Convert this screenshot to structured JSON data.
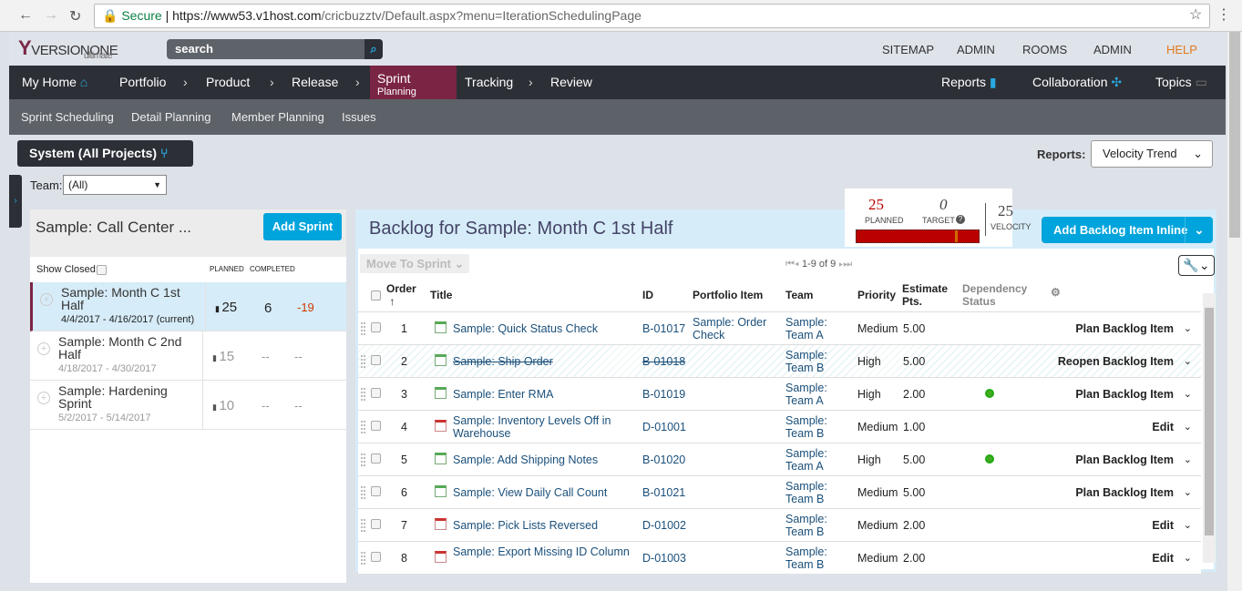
{
  "browser": {
    "secure": "Secure",
    "url_host": "https://www53.v1host.com",
    "url_path": "/cricbuzztv/Default.aspx?menu=IterationSchedulingPage"
  },
  "header": {
    "logo": "VERSIONONE",
    "logo_sub": "ultimate",
    "search_placeholder": "search",
    "links": [
      "SITEMAP",
      "ADMIN",
      "ROOMS",
      "ADMIN",
      "HELP"
    ]
  },
  "nav": {
    "items": [
      "My Home",
      "Portfolio",
      "Product",
      "Release",
      "Sprint",
      "Planning",
      "Tracking",
      "Review"
    ],
    "right": [
      "Reports",
      "Collaboration",
      "Topics"
    ]
  },
  "subnav": [
    "Sprint Scheduling",
    "Detail Planning",
    "Member Planning",
    "Issues"
  ],
  "scope": "System (All Projects)",
  "reports": {
    "label": "Reports:",
    "value": "Velocity Trend"
  },
  "team": {
    "label": "Team:",
    "value": "(All)"
  },
  "left": {
    "title": "Sample: Call Center ...",
    "add_sprint": "Add Sprint",
    "show_closed": "Show Closed:",
    "planned": "PLANNED",
    "completed": "COMPLETED",
    "sprints": [
      {
        "name": "Sample: Month C 1st Half",
        "dates": "4/4/2017 - 4/16/2017 (current)",
        "planned": "25",
        "completed": "6",
        "diff": "-19"
      },
      {
        "name": "Sample: Month C 2nd Half",
        "dates": "4/18/2017 - 4/30/2017",
        "planned": "15",
        "completed": "--",
        "diff": "--"
      },
      {
        "name": "Sample: Hardening Sprint",
        "dates": "5/2/2017 - 5/14/2017",
        "planned": "10",
        "completed": "--",
        "diff": "--"
      }
    ]
  },
  "backlog": {
    "title": "Backlog for Sample: Month C 1st Half",
    "add_inline": "Add Backlog Item Inline",
    "move_to_sprint": "Move To Sprint",
    "pager": "1-9 of 9",
    "velocity": {
      "planned": "25",
      "planned_label": "PLANNED",
      "target": "0",
      "target_label": "TARGET",
      "velocity": "25",
      "velocity_label": "VELOCITY"
    },
    "columns": [
      "Order",
      "Title",
      "ID",
      "Portfolio Item",
      "Team",
      "Priority",
      "Estimate Pts.",
      "Dependency Status"
    ],
    "rows": [
      {
        "order": "1",
        "title": "Sample: Quick Status Check",
        "id": "B-01017",
        "portfolio": "Sample: Order Check",
        "team": "Sample: Team A",
        "priority": "Medium",
        "est": "5.00",
        "action": "Plan Backlog Item",
        "type": "story",
        "dep": false,
        "closed": false
      },
      {
        "order": "2",
        "title": "Sample: Ship Order",
        "id": "B-01018",
        "portfolio": "",
        "team": "Sample: Team B",
        "priority": "High",
        "est": "5.00",
        "action": "Reopen Backlog Item",
        "type": "story",
        "dep": false,
        "closed": true
      },
      {
        "order": "3",
        "title": "Sample: Enter RMA",
        "id": "B-01019",
        "portfolio": "",
        "team": "Sample: Team A",
        "priority": "High",
        "est": "2.00",
        "action": "Plan Backlog Item",
        "type": "story",
        "dep": true,
        "closed": false
      },
      {
        "order": "4",
        "title": "Sample: Inventory Levels Off in Warehouse",
        "id": "D-01001",
        "portfolio": "",
        "team": "Sample: Team B",
        "priority": "Medium",
        "est": "1.00",
        "action": "Edit",
        "type": "defect",
        "dep": false,
        "closed": false
      },
      {
        "order": "5",
        "title": "Sample: Add Shipping Notes",
        "id": "B-01020",
        "portfolio": "",
        "team": "Sample: Team A",
        "priority": "High",
        "est": "5.00",
        "action": "Plan Backlog Item",
        "type": "story",
        "dep": true,
        "closed": false
      },
      {
        "order": "6",
        "title": "Sample: View Daily Call Count",
        "id": "B-01021",
        "portfolio": "",
        "team": "Sample: Team B",
        "priority": "Medium",
        "est": "5.00",
        "action": "Plan Backlog Item",
        "type": "story",
        "dep": false,
        "closed": false
      },
      {
        "order": "7",
        "title": "Sample: Pick Lists Reversed",
        "id": "D-01002",
        "portfolio": "",
        "team": "Sample: Team B",
        "priority": "Medium",
        "est": "2.00",
        "action": "Edit",
        "type": "defect",
        "dep": false,
        "closed": false
      },
      {
        "order": "8",
        "title": "Sample: Export Missing ID Column",
        "id": "D-01003",
        "portfolio": "",
        "team": "Sample: Team B",
        "priority": "Medium",
        "est": "2.00",
        "action": "Edit",
        "type": "defect",
        "dep": false,
        "closed": false
      }
    ]
  }
}
